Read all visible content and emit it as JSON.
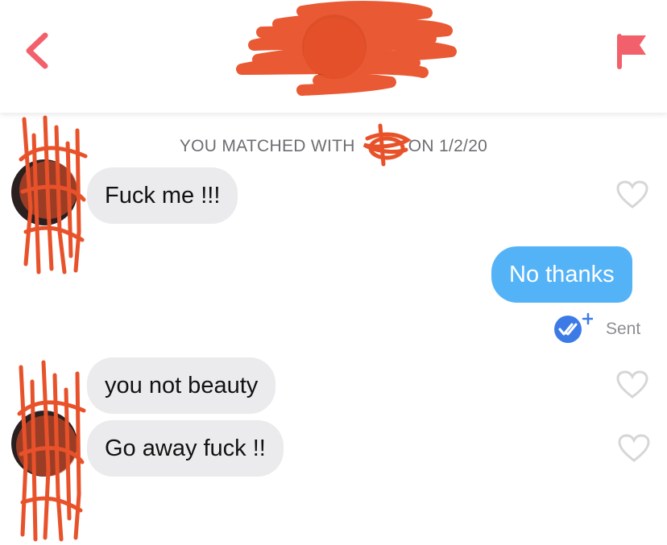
{
  "header": {
    "back_icon": "chevron-left-icon",
    "report_icon": "flag-icon",
    "accent_color": "#f2616b"
  },
  "match_notice": {
    "prefix": "YOU MATCHED WITH",
    "suffix": "ON 1/2/20"
  },
  "messages": [
    {
      "direction": "incoming",
      "text": "Fuck me !!!"
    },
    {
      "direction": "outgoing",
      "text": "No thanks",
      "status": "Sent"
    },
    {
      "direction": "incoming",
      "text": "you not beauty"
    },
    {
      "direction": "incoming",
      "text": "Go away fuck !!"
    }
  ],
  "colors": {
    "incoming_bubble": "#ebebed",
    "outgoing_bubble": "#54b3f7",
    "read_receipt": "#3c7be6",
    "redaction": "#e8522a"
  }
}
